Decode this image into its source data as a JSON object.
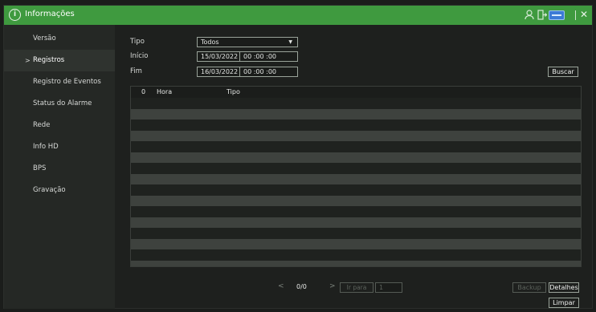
{
  "titlebar": {
    "title": "Informações",
    "info_icon": "i",
    "icons": [
      "user-icon",
      "exit-icon",
      "hdd-icon",
      "close-icon"
    ]
  },
  "sidebar": {
    "items": [
      {
        "label": "Versão",
        "active": false
      },
      {
        "label": "Registros",
        "active": true
      },
      {
        "label": "Registro de Eventos",
        "active": false
      },
      {
        "label": "Status do Alarme",
        "active": false
      },
      {
        "label": "Rede",
        "active": false
      },
      {
        "label": "Info HD",
        "active": false
      },
      {
        "label": "BPS",
        "active": false
      },
      {
        "label": "Gravação",
        "active": false
      }
    ],
    "active_marker": ">"
  },
  "filters": {
    "tipo_label": "Tipo",
    "tipo_value": "Todos",
    "inicio_label": "Início",
    "inicio_date": "15/03/2022",
    "inicio_time": "00 :00 :00",
    "fim_label": "Fim",
    "fim_date": "16/03/2022",
    "fim_time": "00 :00 :00",
    "search_label": "Buscar"
  },
  "table": {
    "columns": [
      "0",
      "Hora",
      "Tipo"
    ],
    "row_count": 16
  },
  "pager": {
    "page_info": "0/0",
    "goto_label": "Ir para",
    "goto_value": "1"
  },
  "actions": {
    "backup_label": "Backup",
    "details_label": "Detalhes",
    "clear_label": "Limpar"
  },
  "colors": {
    "accent": "#3f9a3f",
    "row_stripe": "#3e423e"
  }
}
